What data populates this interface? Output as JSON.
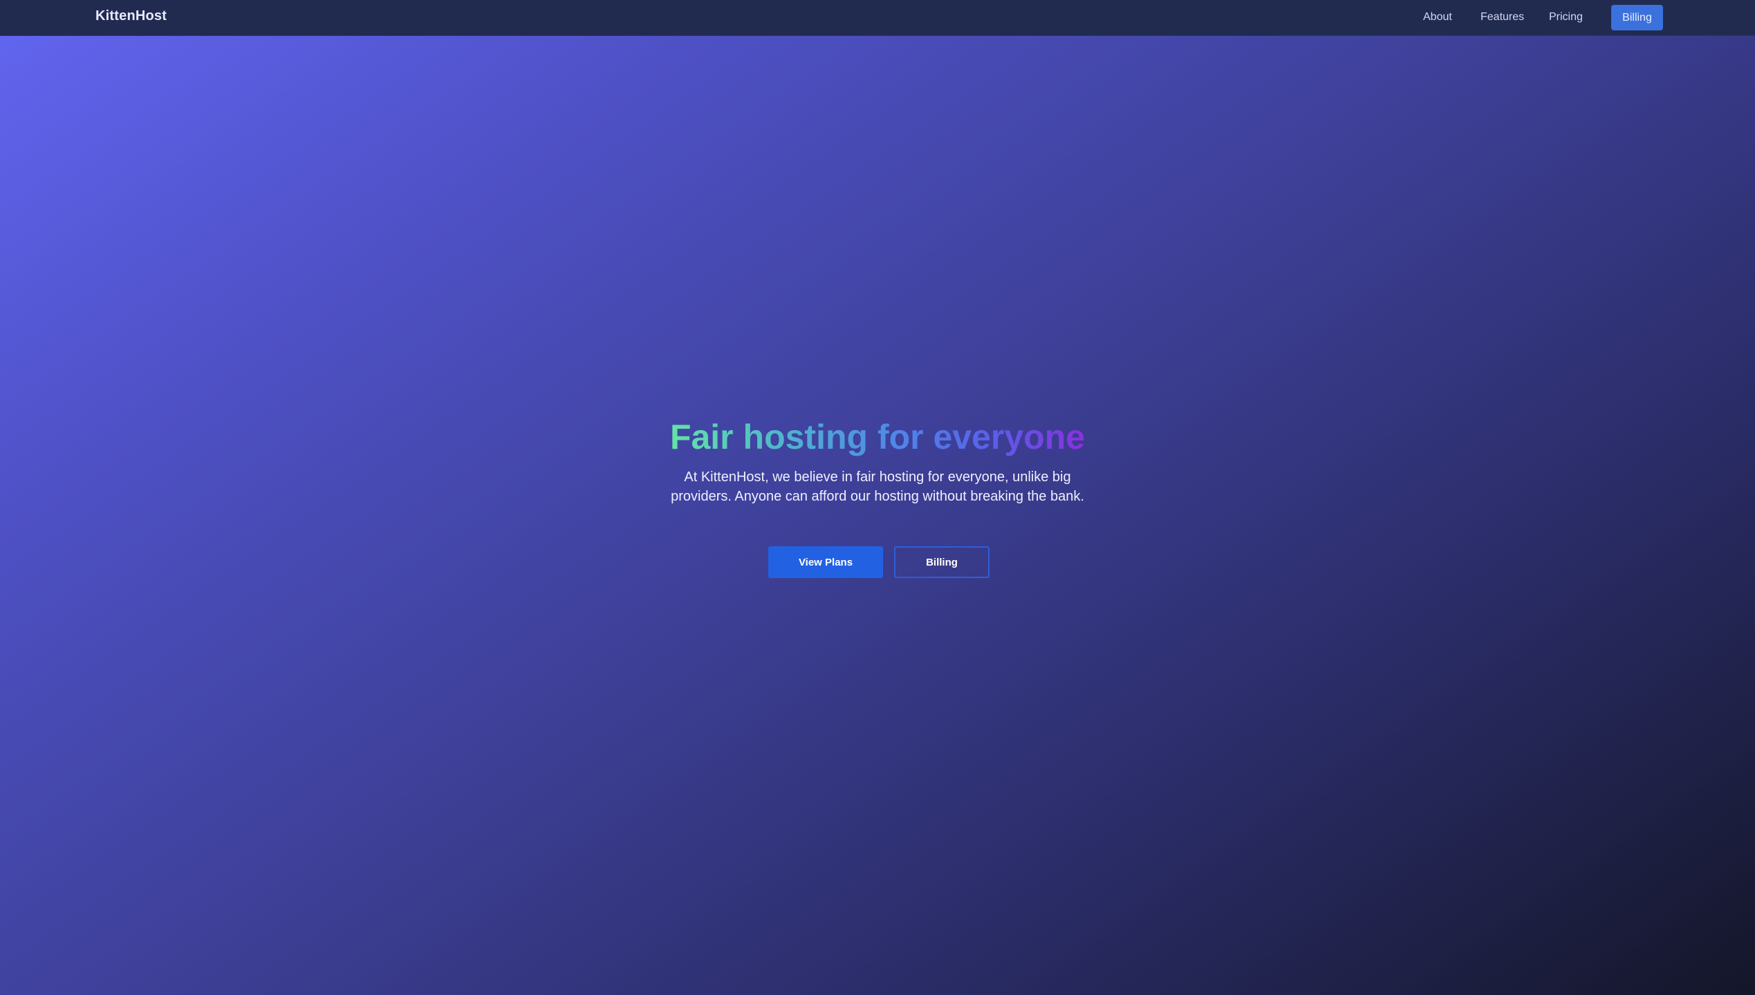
{
  "navbar": {
    "brand": "KittenHost",
    "links": [
      {
        "label": "About"
      },
      {
        "label": "Features"
      },
      {
        "label": "Pricing"
      }
    ],
    "cta_label": "Billing"
  },
  "hero": {
    "title": "Fair hosting for everyone",
    "description": "At KittenHost, we believe in fair hosting for everyone, unlike big providers. Anyone can afford our hosting without breaking the bank.",
    "primary_button": "View Plans",
    "secondary_button": "Billing"
  },
  "colors": {
    "navbar_bg": "#212a4f",
    "accent_blue": "#2361e3",
    "gradient_start": "#63e5a3",
    "gradient_end": "#8b2fe0"
  }
}
